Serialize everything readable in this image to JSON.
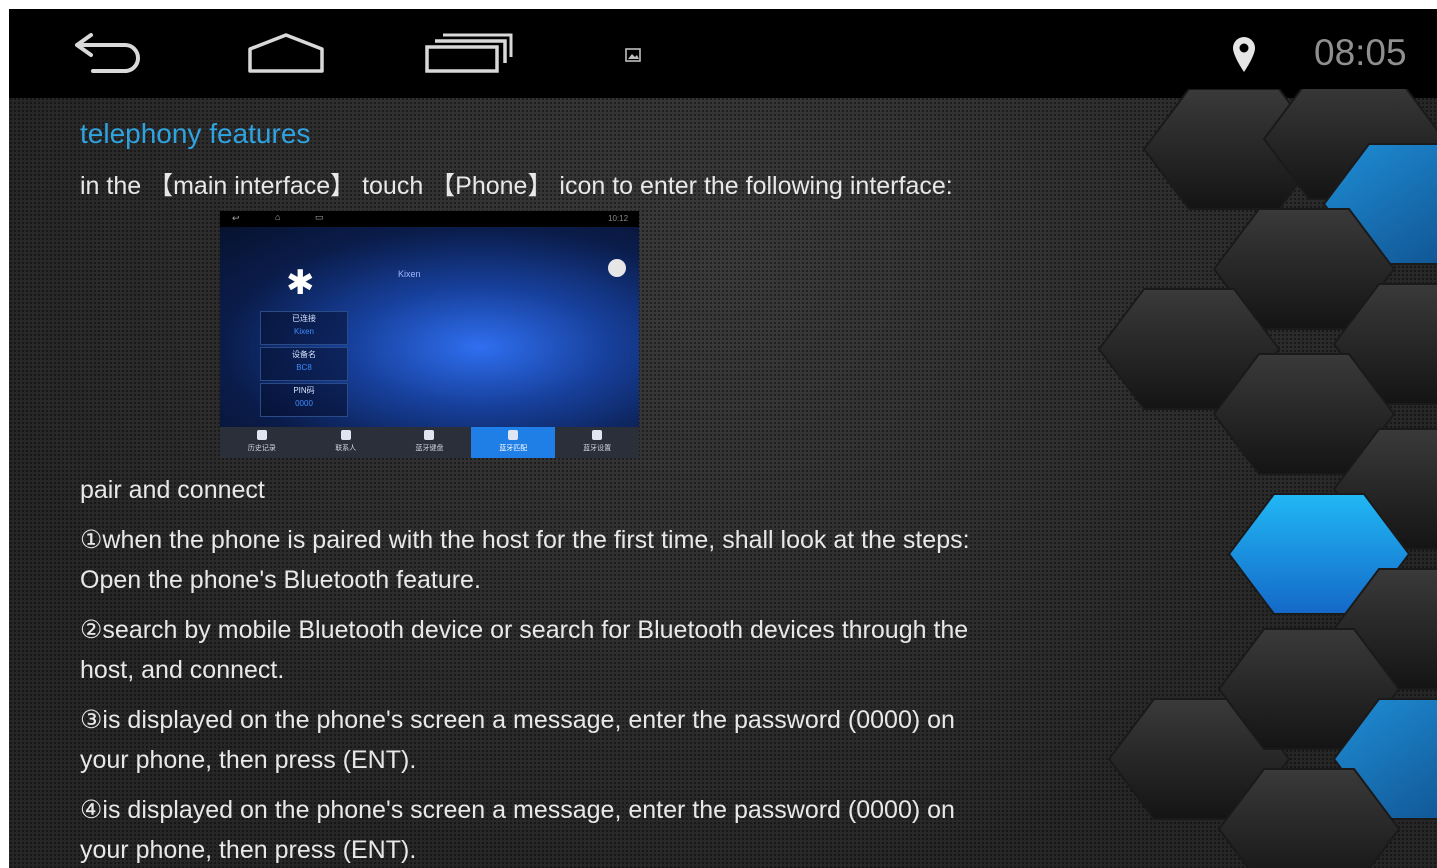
{
  "status_bar": {
    "time": "08:05",
    "icons": [
      "back-icon",
      "home-icon",
      "recent-apps-icon",
      "image-notification-icon",
      "location-icon"
    ]
  },
  "content": {
    "title": "telephony features",
    "intro": "in the 【main interface】 touch 【Phone】 icon to enter the following interface:",
    "section_heading": "pair and connect",
    "steps": [
      {
        "line1": "①when the phone is paired with the host for the first time, shall look at the steps:",
        "line2": "Open the phone's Bluetooth feature."
      },
      {
        "line1": "②search by mobile Bluetooth device or search for Bluetooth devices through the",
        "line2": "host, and connect."
      },
      {
        "line1": "③is displayed on the phone's screen a message, enter the password (0000) on",
        "line2": "your phone, then press (ENT)."
      },
      {
        "line1": "④is displayed on the phone's screen a message, enter the password (0000) on",
        "line2": "your phone, then press (ENT)."
      }
    ]
  },
  "embedded_screenshot": {
    "time": "10:12",
    "device_label": "Kixen",
    "info_boxes": [
      {
        "label": "已连接",
        "value": "Kixen"
      },
      {
        "label": "设备名",
        "value": "BC8"
      },
      {
        "label": "PIN码",
        "value": "0000"
      }
    ],
    "tabs": [
      "历史记录",
      "联系人",
      "蓝牙键盘",
      "蓝牙匹配",
      "蓝牙设置"
    ],
    "active_tab_index": 3
  },
  "colors": {
    "title": "#2fa3e0",
    "body_text": "#e8e8e8",
    "clock": "#8f8f8f",
    "hex_accent": "#1aa3e6"
  }
}
